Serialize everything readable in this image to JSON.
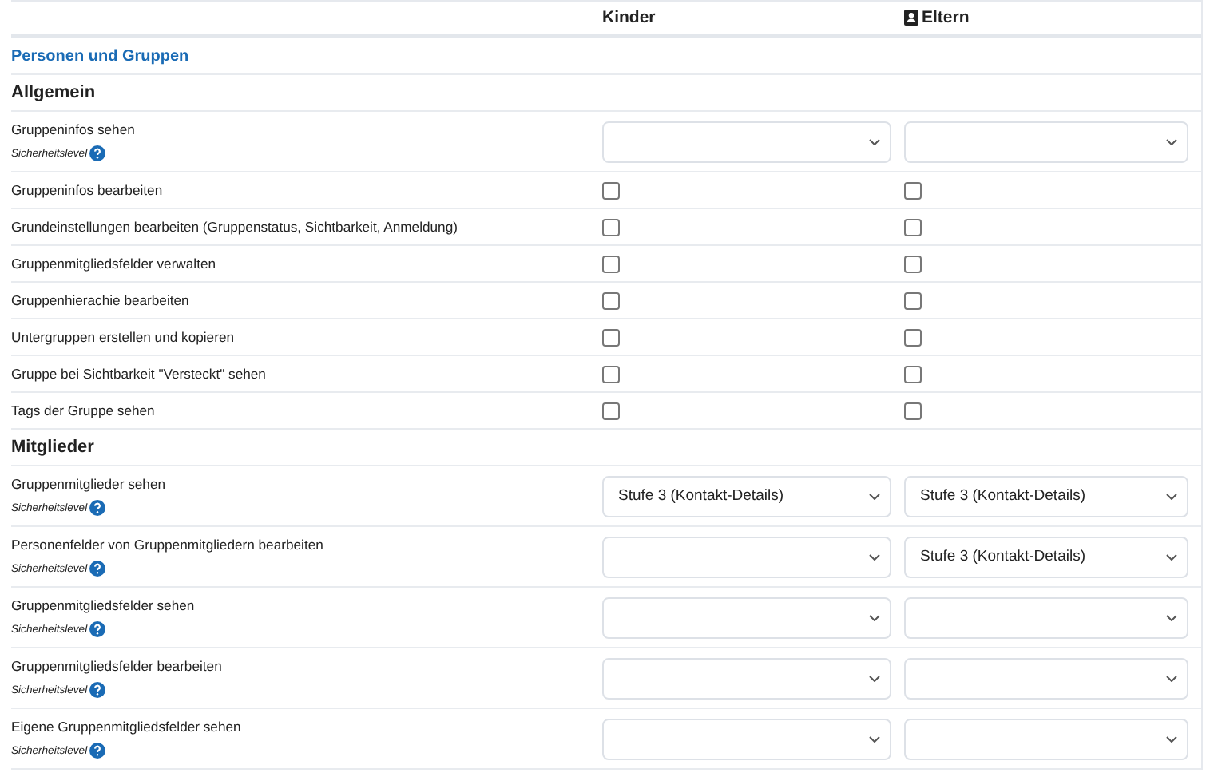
{
  "columns": [
    {
      "label": "Kinder",
      "kind": "plain"
    },
    {
      "label": "Eltern",
      "kind": "contact"
    }
  ],
  "category": "Personen und Gruppen",
  "sections": [
    {
      "title": "Allgemein",
      "rows": [
        {
          "label": "Gruppeninfos sehen",
          "kind": "select",
          "hint": "Sicherheitslevel",
          "cells": [
            {},
            {}
          ]
        },
        {
          "label": "Gruppeninfos bearbeiten",
          "kind": "checkbox",
          "cells": [
            {
              "checked": false
            },
            {
              "checked": false
            }
          ]
        },
        {
          "label": "Grundeinstellungen bearbeiten (Gruppenstatus, Sichtbarkeit, Anmeldung)",
          "kind": "checkbox",
          "cells": [
            {
              "checked": false
            },
            {
              "checked": false
            }
          ]
        },
        {
          "label": "Gruppenmitgliedsfelder verwalten",
          "kind": "checkbox",
          "cells": [
            {
              "checked": false
            },
            {
              "checked": false
            }
          ]
        },
        {
          "label": "Gruppenhierachie bearbeiten",
          "kind": "checkbox",
          "cells": [
            {
              "checked": false
            },
            {
              "checked": false
            }
          ]
        },
        {
          "label": "Untergruppen erstellen und kopieren",
          "kind": "checkbox",
          "cells": [
            {
              "checked": false
            },
            {
              "checked": false
            }
          ]
        },
        {
          "label": "Gruppe bei Sichtbarkeit \"Versteckt\" sehen",
          "kind": "checkbox",
          "cells": [
            {
              "checked": false
            },
            {
              "checked": false
            }
          ]
        },
        {
          "label": "Tags der Gruppe sehen",
          "kind": "checkbox",
          "cells": [
            {
              "checked": false
            },
            {
              "checked": false
            }
          ]
        }
      ]
    },
    {
      "title": "Mitglieder",
      "rows": [
        {
          "label": "Gruppenmitglieder sehen",
          "kind": "select",
          "hint": "Sicherheitslevel",
          "cells": [
            {
              "value": "Stufe 3 (Kontakt-Details)"
            },
            {
              "value": "Stufe 3 (Kontakt-Details)"
            }
          ]
        },
        {
          "label": "Personenfelder von Gruppenmitgliedern bearbeiten",
          "kind": "select",
          "hint": "Sicherheitslevel",
          "cells": [
            {},
            {
              "value": "Stufe 3 (Kontakt-Details)"
            }
          ]
        },
        {
          "label": "Gruppenmitgliedsfelder sehen",
          "kind": "select",
          "hint": "Sicherheitslevel",
          "cells": [
            {},
            {}
          ]
        },
        {
          "label": "Gruppenmitgliedsfelder bearbeiten",
          "kind": "select",
          "hint": "Sicherheitslevel",
          "cells": [
            {},
            {}
          ]
        },
        {
          "label": "Eigene Gruppenmitgliedsfelder sehen",
          "kind": "select",
          "hint": "Sicherheitslevel",
          "cells": [
            {},
            {}
          ]
        }
      ]
    }
  ]
}
